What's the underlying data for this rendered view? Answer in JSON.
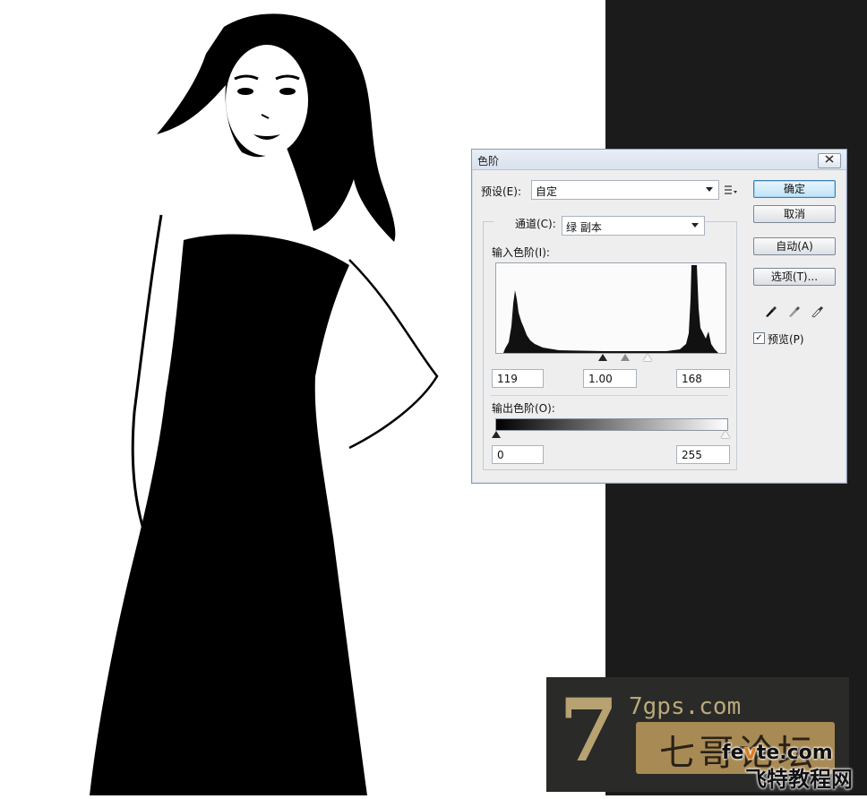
{
  "dialog": {
    "title": "色阶",
    "preset_label": "预设(E):",
    "preset_value": "自定",
    "channel_label": "通道(C):",
    "channel_value": "绿 副本",
    "input_levels_label": "输入色阶(I):",
    "input_black": "119",
    "input_gamma": "1.00",
    "input_white": "168",
    "output_levels_label": "输出色阶(O):",
    "output_black": "0",
    "output_white": "255",
    "buttons": {
      "ok": "确定",
      "cancel": "取消",
      "auto": "自动(A)",
      "options": "选项(T)..."
    },
    "preview_label": "预览(P)",
    "preview_checked": true
  },
  "watermark": {
    "logo_seven": "7",
    "site_url": "7gps.com",
    "forum_name": "七哥论坛",
    "domain_pre": "fe",
    "domain_e": "v",
    "domain_post": "te.com",
    "cn_name": "飞特教程网"
  },
  "colors": {
    "default_button": "#bfe3f8",
    "dark_panel": "#1b1b1b"
  }
}
